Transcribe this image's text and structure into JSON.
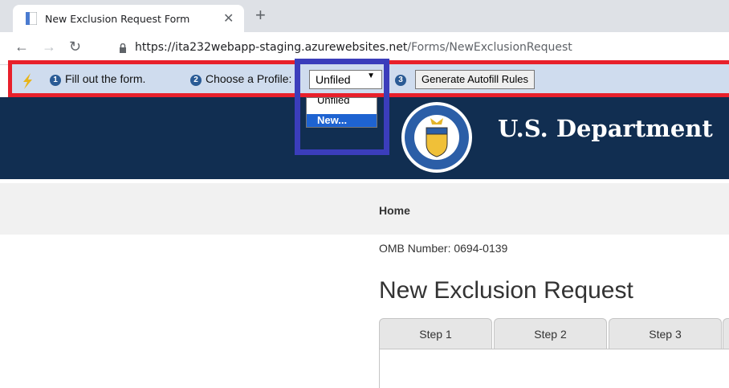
{
  "browser": {
    "tab_title": "New Exclusion Request Form",
    "url_host": "https://ita232webapp-staging.azurewebsites.net",
    "url_path": "/Forms/NewExclusionRequest"
  },
  "toolbar": {
    "step1_num": "1",
    "step1_label": "Fill out the form.",
    "step2_num": "2",
    "step2_label": "Choose a Profile:",
    "profile_selected": "Unfiled",
    "step3_num": "3",
    "generate_label": "Generate Autofill Rules"
  },
  "dropdown": {
    "options": [
      "Unfiled",
      "New..."
    ]
  },
  "header": {
    "department": "U.S. Department"
  },
  "nav": {
    "home": "Home"
  },
  "main": {
    "omb": "OMB Number: 0694-0139",
    "title": "New Exclusion Request",
    "tabs": [
      "Step 1",
      "Step 2",
      "Step 3"
    ]
  },
  "colors": {
    "banner": "#112e51",
    "highlight_box": "#3b3dbb",
    "toolbar_border": "#e8202b",
    "toolbar_bg": "#cfdcee",
    "selected_option": "#1e63d1"
  }
}
